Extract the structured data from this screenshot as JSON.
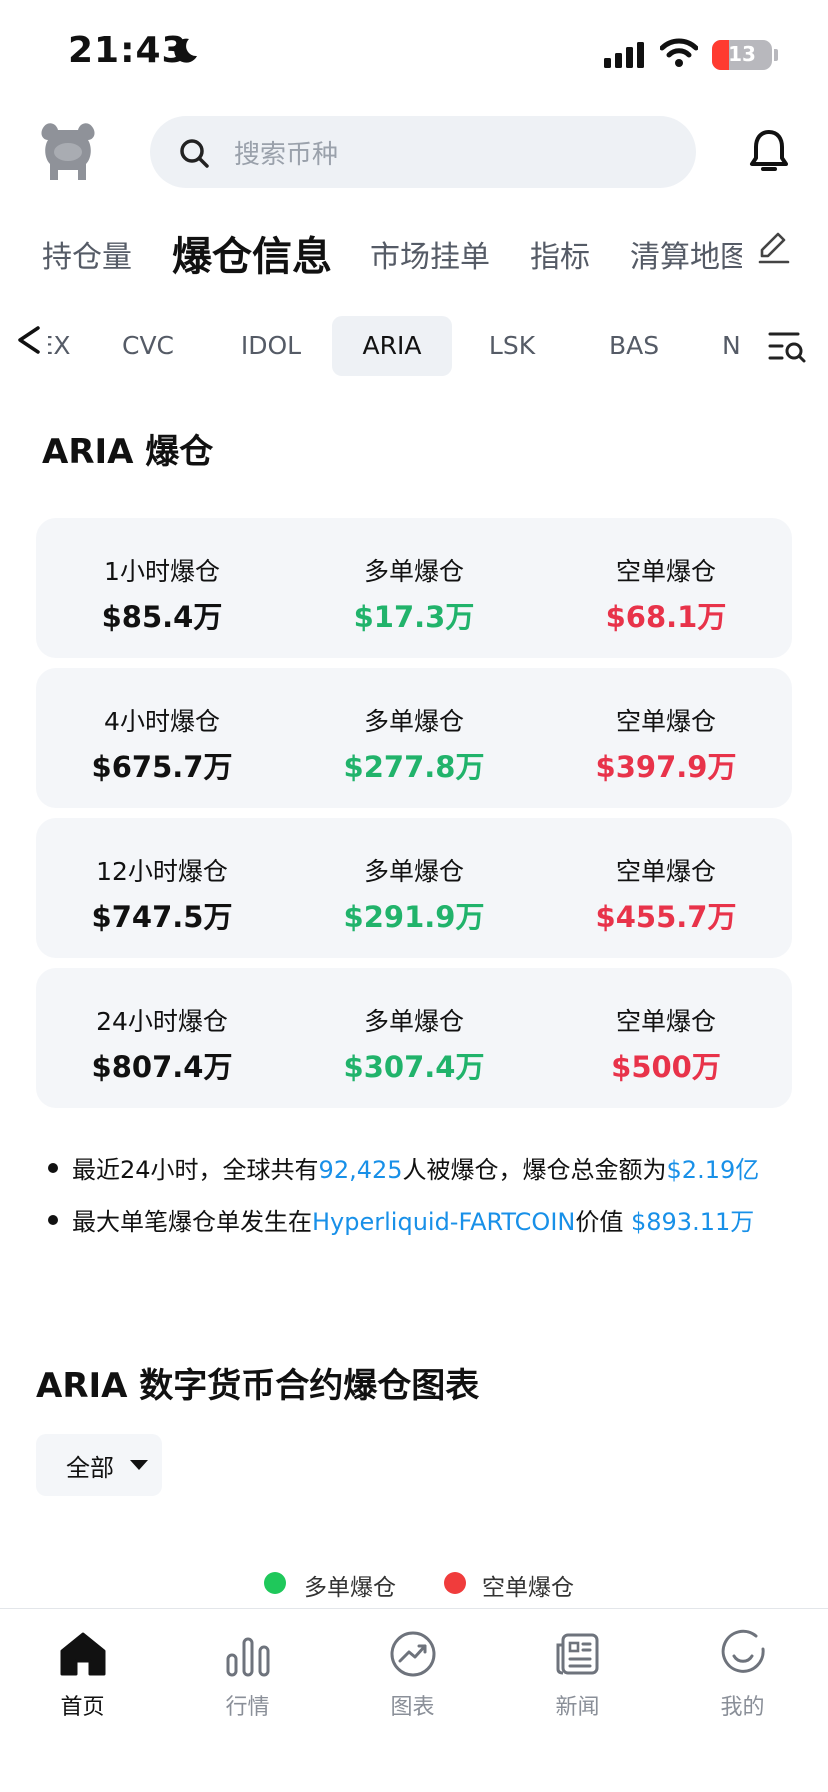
{
  "status_bar": {
    "time": "21:43",
    "battery_level": "13"
  },
  "header": {
    "search_placeholder": "搜索币种"
  },
  "main_tabs": [
    {
      "label": "持仓量"
    },
    {
      "label": "爆仓信息"
    },
    {
      "label": "市场挂单"
    },
    {
      "label": "指标"
    },
    {
      "label": "清算地图"
    }
  ],
  "coin_tabs": [
    {
      "label": "EX"
    },
    {
      "label": "CVC"
    },
    {
      "label": "IDOL"
    },
    {
      "label": "ARIA"
    },
    {
      "label": "LSK"
    },
    {
      "label": "BAS"
    },
    {
      "label": "N"
    }
  ],
  "section_title": "ARIA 爆仓",
  "cards": [
    {
      "total_label": "1小时爆仓",
      "total_value": "$85.4万",
      "long_label": "多单爆仓",
      "long_value": "$17.3万",
      "short_label": "空单爆仓",
      "short_value": "$68.1万"
    },
    {
      "total_label": "4小时爆仓",
      "total_value": "$675.7万",
      "long_label": "多单爆仓",
      "long_value": "$277.8万",
      "short_label": "空单爆仓",
      "short_value": "$397.9万"
    },
    {
      "total_label": "12小时爆仓",
      "total_value": "$747.5万",
      "long_label": "多单爆仓",
      "long_value": "$291.9万",
      "short_label": "空单爆仓",
      "short_value": "$455.7万"
    },
    {
      "total_label": "24小时爆仓",
      "total_value": "$807.4万",
      "long_label": "多单爆仓",
      "long_value": "$307.4万",
      "short_label": "空单爆仓",
      "short_value": "$500万"
    }
  ],
  "notes": {
    "line1_prefix": "最近24小时，全球共有",
    "line1_count": "92,425",
    "line1_mid": "人被爆仓，爆仓总金额为",
    "line1_amount": "$2.19亿",
    "line2_prefix": "最大单笔爆仓单发生在",
    "line2_pair": "Hyperliquid-FARTCOIN",
    "line2_mid": "价值",
    "line2_amount": "$893.11万"
  },
  "chart": {
    "title": "ARIA 数字货币合约爆仓图表",
    "filter_value": "全部",
    "legend_long": "多单爆仓",
    "legend_short": "空单爆仓",
    "long_color": "#1fc85b",
    "short_color": "#f03c3c"
  },
  "bottom_nav": [
    {
      "label": "首页",
      "icon": "home-icon"
    },
    {
      "label": "行情",
      "icon": "bar-chart-icon"
    },
    {
      "label": "图表",
      "icon": "trend-chart-icon"
    },
    {
      "label": "新闻",
      "icon": "news-icon"
    },
    {
      "label": "我的",
      "icon": "profile-icon"
    }
  ],
  "colors": {
    "long": "#21b36b",
    "short": "#e8334a",
    "link": "#1890e8",
    "card_bg": "#f4f6f9"
  }
}
